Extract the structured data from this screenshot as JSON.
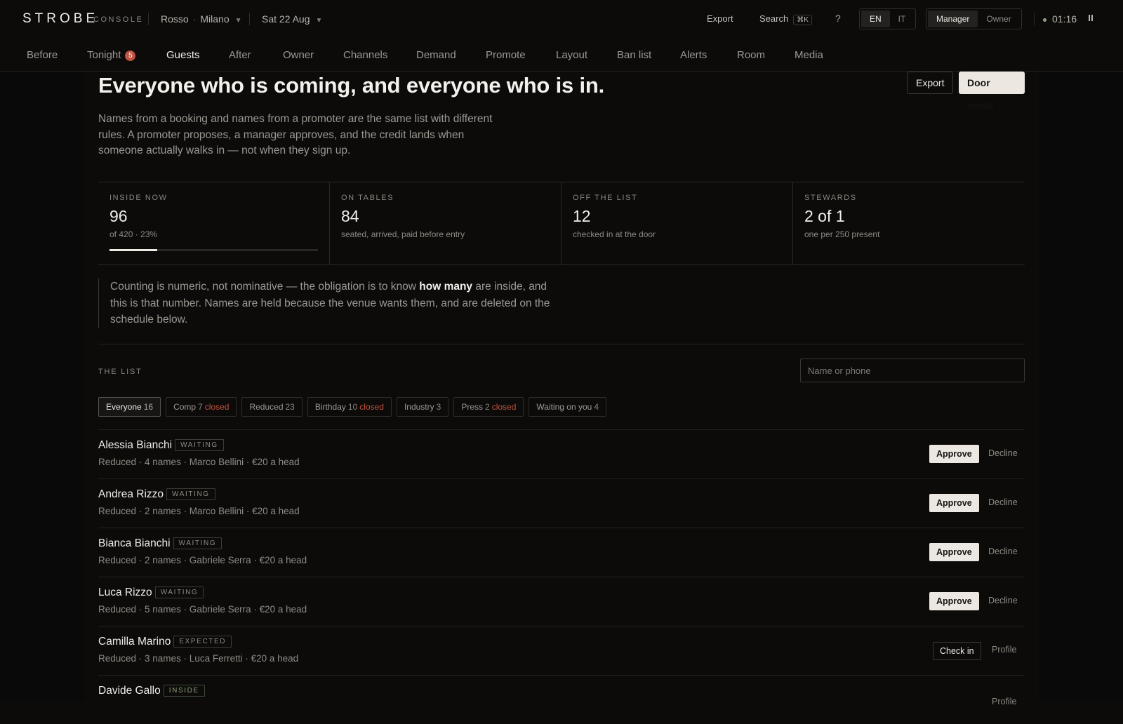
{
  "app": {
    "brand": "STROBE",
    "brand_sub": "CONSOLE"
  },
  "topbar": {
    "venue_name": "Rosso",
    "venue_city": "Milano",
    "date": "Sat 22 Aug",
    "export_label": "Export",
    "search_label": "Search",
    "search_shortcut": "⌘K",
    "help_label": "?",
    "lang_en": "EN",
    "lang_it": "IT",
    "role_manager": "Manager",
    "role_owner": "Owner",
    "timer": "01:16"
  },
  "nav": {
    "before": "Before",
    "tonight": "Tonight",
    "tonight_badge": "5",
    "guests": "Guests",
    "after": "After",
    "owner": "Owner",
    "channels": "Channels",
    "demand": "Demand",
    "promote": "Promote",
    "layout": "Layout",
    "ban_list": "Ban list",
    "alerts": "Alerts",
    "room": "Room",
    "media": "Media"
  },
  "page": {
    "title": "Everyone who is coming, and everyone who is in.",
    "export_button": "Export",
    "door_mode_button": "Door mode",
    "lede": "Names from a booking and names from a promoter are the same list with different rules. A promoter proposes, a manager approves, and the credit lands when someone actually walks in — not when they sign up."
  },
  "stats": {
    "inside": {
      "label": "INSIDE NOW",
      "value": "96",
      "sub": "of 420 · 23%",
      "progress_fraction": 0.23
    },
    "tables": {
      "label": "ON TABLES",
      "value": "84",
      "sub": "seated, arrived, paid before entry"
    },
    "off_list": {
      "label": "OFF THE LIST",
      "value": "12",
      "sub": "checked in at the door"
    },
    "stewards": {
      "label": "STEWARDS",
      "value": "2 of 1",
      "sub": "one per 250 present"
    }
  },
  "note": {
    "before": "Counting is numeric, not nominative — the obligation is to know ",
    "bold": "how many",
    "after": " are inside, and this is that number. Names are held because the venue wants them, and are deleted on the schedule below."
  },
  "list": {
    "label": "THE LIST",
    "search_placeholder": "Name or phone",
    "closed_word": "closed",
    "filters": {
      "everyone": {
        "label": "Everyone",
        "count": "16"
      },
      "comp": {
        "label": "Comp",
        "count": "7"
      },
      "reduced": {
        "label": "Reduced",
        "count": "23"
      },
      "birthday": {
        "label": "Birthday",
        "count": "10"
      },
      "industry": {
        "label": "Industry",
        "count": "3"
      },
      "press": {
        "label": "Press",
        "count": "2"
      },
      "waiting": {
        "label": "Waiting on you",
        "count": "4"
      }
    },
    "actions": {
      "approve": "Approve",
      "decline": "Decline",
      "check_in": "Check in",
      "profile": "Profile"
    },
    "guests": [
      {
        "name": "Alessia Bianchi",
        "status": "WAITING",
        "meta": "Reduced · 4 names · Marco Bellini · €20 a head"
      },
      {
        "name": "Andrea Rizzo",
        "status": "WAITING",
        "meta": "Reduced · 2 names · Marco Bellini · €20 a head"
      },
      {
        "name": "Bianca Bianchi",
        "status": "WAITING",
        "meta": "Reduced · 2 names · Gabriele Serra · €20 a head"
      },
      {
        "name": "Luca Rizzo",
        "status": "WAITING",
        "meta": "Reduced · 5 names · Gabriele Serra · €20 a head"
      },
      {
        "name": "Camilla Marino",
        "status": "EXPECTED",
        "meta": "Reduced · 3 names · Luca Ferretti · €20 a head"
      },
      {
        "name": "Davide Gallo",
        "status": "INSIDE",
        "meta": ""
      }
    ]
  },
  "colors": {
    "background": "#0c0b0a",
    "accent_red": "#c0533f",
    "live_green": "#8ea37e",
    "button_light": "#ece8e1"
  }
}
